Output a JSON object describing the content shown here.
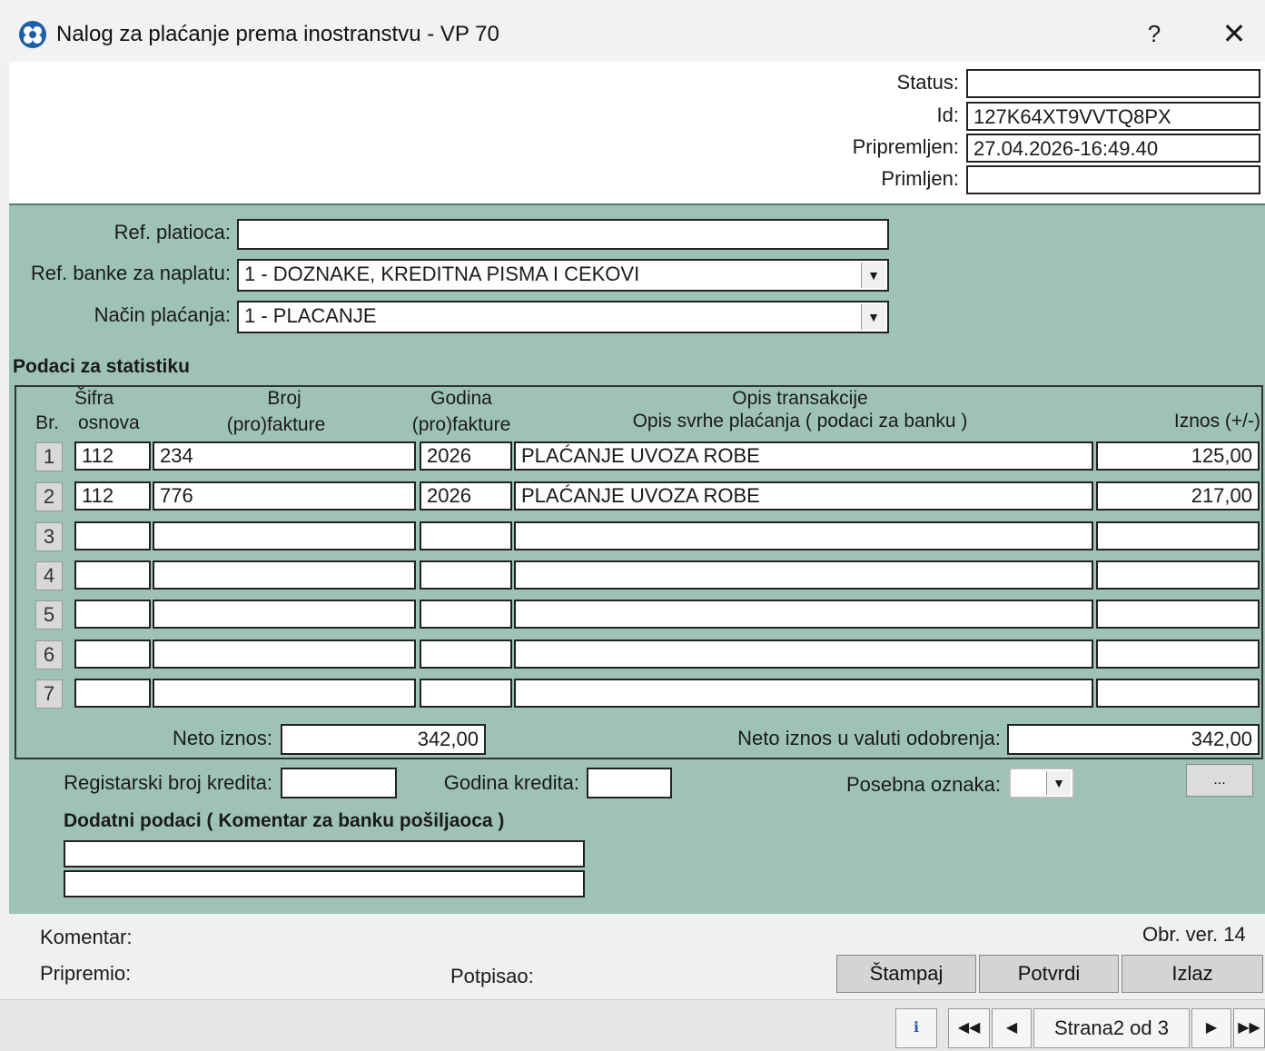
{
  "window": {
    "title": "Nalog za plaćanje prema inostranstvu - VP 70",
    "help": "?",
    "close": "✕"
  },
  "status": {
    "status_label": "Status:",
    "status_value": "",
    "id_label": "Id:",
    "id_value": "127K64XT9VVTQ8PX",
    "prepared_label": "Pripremljen:",
    "prepared_value": "27.04.2026-16:49.40",
    "received_label": "Primljen:",
    "received_value": ""
  },
  "form": {
    "ref_payer_label": "Ref. platioca:",
    "ref_payer_value": "",
    "ref_bank_label": "Ref. banke za naplatu:",
    "ref_bank_value": "1 - DOZNAKE, KREDITNA PISMA I CEKOVI",
    "payment_method_label": "Način plaćanja:",
    "payment_method_value": "1 - PLACANJE"
  },
  "stats": {
    "heading": "Podaci za statistiku",
    "headers": {
      "br": "Br.",
      "sifra1": "Šifra",
      "sifra2": "osnova",
      "broj1": "Broj",
      "broj2": "(pro)fakture",
      "godina1": "Godina",
      "godina2": "(pro)fakture",
      "opis1": "Opis transakcije",
      "opis2": "Opis svrhe plaćanja ( podaci za banku )",
      "iznos": "Iznos (+/-)"
    },
    "rows": [
      {
        "num": "1",
        "sifra": "112",
        "broj": "234",
        "godina": "2026",
        "opis": "PLAĆANJE UVOZA ROBE",
        "iznos": "125,00"
      },
      {
        "num": "2",
        "sifra": "112",
        "broj": "776",
        "godina": "2026",
        "opis": "PLAĆANJE UVOZA ROBE",
        "iznos": "217,00"
      },
      {
        "num": "3",
        "sifra": "",
        "broj": "",
        "godina": "",
        "opis": "",
        "iznos": ""
      },
      {
        "num": "4",
        "sifra": "",
        "broj": "",
        "godina": "",
        "opis": "",
        "iznos": ""
      },
      {
        "num": "5",
        "sifra": "",
        "broj": "",
        "godina": "",
        "opis": "",
        "iznos": ""
      },
      {
        "num": "6",
        "sifra": "",
        "broj": "",
        "godina": "",
        "opis": "",
        "iznos": ""
      },
      {
        "num": "7",
        "sifra": "",
        "broj": "",
        "godina": "",
        "opis": "",
        "iznos": ""
      }
    ],
    "net_label": "Neto iznos:",
    "net_value": "342,00",
    "net_currency_label": "Neto iznos u valuti odobrenja:",
    "net_currency_value": "342,00"
  },
  "credit": {
    "reg_label": "Registarski broj kredita:",
    "reg_value": "",
    "year_label": "Godina kredita:",
    "year_value": "",
    "special_label": "Posebna oznaka:",
    "special_value": "",
    "ellipsis": "..."
  },
  "extra": {
    "heading": "Dodatni podaci ( Komentar za banku pošiljaoca )",
    "line1": "",
    "line2": ""
  },
  "footer": {
    "comment_label": "Komentar:",
    "prepared_by_label": "Pripremio:",
    "signed_label": "Potpisao:",
    "version": "Obr. ver. 14",
    "print_btn": "Štampaj",
    "confirm_btn": "Potvrdi",
    "exit_btn": "Izlaz"
  },
  "nav": {
    "page_text": "Strana2 od 3"
  }
}
